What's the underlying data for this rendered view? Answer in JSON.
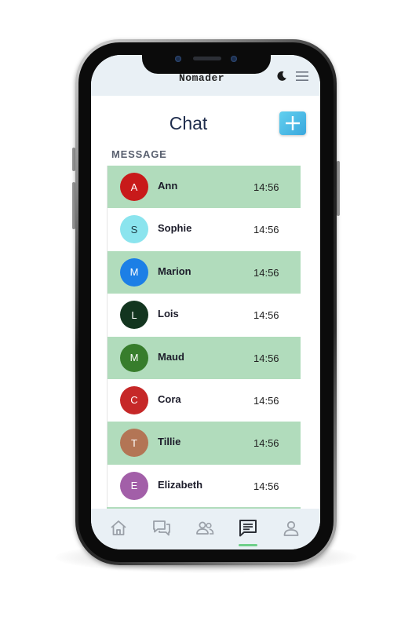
{
  "app": {
    "brand": "Nomader"
  },
  "header": {
    "moon_icon": "moon-icon",
    "menu_icon": "hamburger-menu-icon"
  },
  "page": {
    "title": "Chat",
    "add_icon": "plus-icon",
    "section_label": "MESSAGE"
  },
  "colors": {
    "row_highlight": "#b1dcbc",
    "topbar": "#e9f0f5",
    "title": "#1f2d4d",
    "add_button": "#3aa7dd",
    "nav_active": "#6fd08a"
  },
  "chats": [
    {
      "initial": "A",
      "name": "Ann",
      "time": "14:56",
      "avatar_color": "#c81a1a",
      "highlighted": true
    },
    {
      "initial": "S",
      "name": "Sophie",
      "time": "14:56",
      "avatar_color": "#8be4ee",
      "highlighted": false
    },
    {
      "initial": "M",
      "name": "Marion",
      "time": "14:56",
      "avatar_color": "#1c7fe6",
      "highlighted": true
    },
    {
      "initial": "L",
      "name": "Lois",
      "time": "14:56",
      "avatar_color": "#13351f",
      "highlighted": false
    },
    {
      "initial": "M",
      "name": "Maud",
      "time": "14:56",
      "avatar_color": "#377d2c",
      "highlighted": true
    },
    {
      "initial": "C",
      "name": "Cora",
      "time": "14:56",
      "avatar_color": "#c62828",
      "highlighted": false
    },
    {
      "initial": "T",
      "name": "Tillie",
      "time": "14:56",
      "avatar_color": "#b37555",
      "highlighted": true
    },
    {
      "initial": "E",
      "name": "Elizabeth",
      "time": "14:56",
      "avatar_color": "#a25fa8",
      "highlighted": false
    }
  ],
  "bottom_nav": [
    {
      "icon": "home-icon",
      "active": false
    },
    {
      "icon": "chat-bubbles-icon",
      "active": false
    },
    {
      "icon": "contacts-icon",
      "active": false
    },
    {
      "icon": "message-icon",
      "active": true
    },
    {
      "icon": "profile-icon",
      "active": false
    }
  ]
}
